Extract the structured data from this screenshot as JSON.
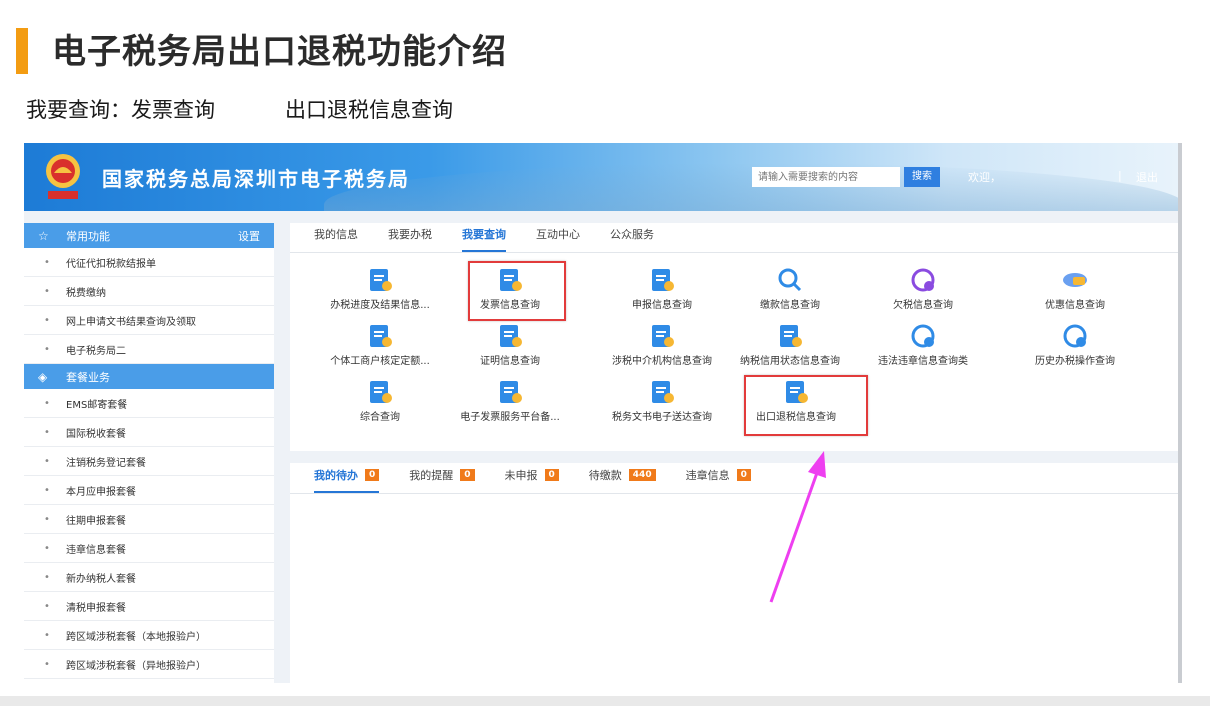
{
  "slide": {
    "title": "电子税务局出口退税功能介绍",
    "subtitle_left": "我要查询：发票查询",
    "subtitle_right": "出口退税信息查询",
    "accent": "#f39c12"
  },
  "header": {
    "site_title": "国家税务总局深圳市电子税务局",
    "search_placeholder": "请输入需要搜索的内容",
    "search_button": "搜索",
    "welcome": "欢迎，",
    "separator": "|",
    "logout": "退出",
    "brand_color": "#2576d6"
  },
  "sidebar": {
    "common_header": "常用功能",
    "settings": "设置",
    "common_items": [
      "代征代扣税款结报单",
      "税费缴纳",
      "网上申请文书结果查询及领取",
      "电子税务局二"
    ],
    "package_header": "套餐业务",
    "package_items": [
      "EMS邮寄套餐",
      "国际税收套餐",
      "注销税务登记套餐",
      "本月应申报套餐",
      "往期申报套餐",
      "违章信息套餐",
      "新办纳税人套餐",
      "清税申报套餐",
      "跨区域涉税套餐（本地报验户）",
      "跨区域涉税套餐（异地报验户）"
    ]
  },
  "main_tabs": [
    "我的信息",
    "我要办税",
    "我要查询",
    "互动中心",
    "公众服务"
  ],
  "active_tab": "我要查询",
  "query_items": [
    {
      "label": "办税进度及结果信息...",
      "icon": "progress-icon"
    },
    {
      "label": "发票信息查询",
      "icon": "invoice-search-icon"
    },
    {
      "label": "申报信息查询",
      "icon": "declaration-icon"
    },
    {
      "label": "缴款信息查询",
      "icon": "magnifier-icon"
    },
    {
      "label": "欠税信息查询",
      "icon": "owed-tax-icon"
    },
    {
      "label": "优惠信息查询",
      "icon": "discount-icon"
    },
    {
      "label": "个体工商户核定定额...",
      "icon": "merchant-icon"
    },
    {
      "label": "证明信息查询",
      "icon": "certificate-icon"
    },
    {
      "label": "涉税中介机构信息查询",
      "icon": "agency-icon"
    },
    {
      "label": "纳税信用状态信息查询",
      "icon": "credit-icon"
    },
    {
      "label": "违法违章信息查询类",
      "icon": "violation-icon"
    },
    {
      "label": "历史办税操作查询",
      "icon": "history-icon"
    },
    {
      "label": "综合查询",
      "icon": "comprehensive-icon"
    },
    {
      "label": "电子发票服务平台备...",
      "icon": "e-invoice-icon"
    },
    {
      "label": "税务文书电子送达查询",
      "icon": "document-delivery-icon"
    },
    {
      "label": "出口退税信息查询",
      "icon": "export-refund-icon"
    }
  ],
  "bottom_tabs": [
    {
      "label": "我的待办",
      "count": "0"
    },
    {
      "label": "我的提醒",
      "count": "0"
    },
    {
      "label": "未申报",
      "count": "0"
    },
    {
      "label": "待缴款",
      "count": "440"
    },
    {
      "label": "违章信息",
      "count": "0"
    }
  ],
  "highlight_color": "#e23b3b",
  "arrow_color": "#ee3ff0"
}
